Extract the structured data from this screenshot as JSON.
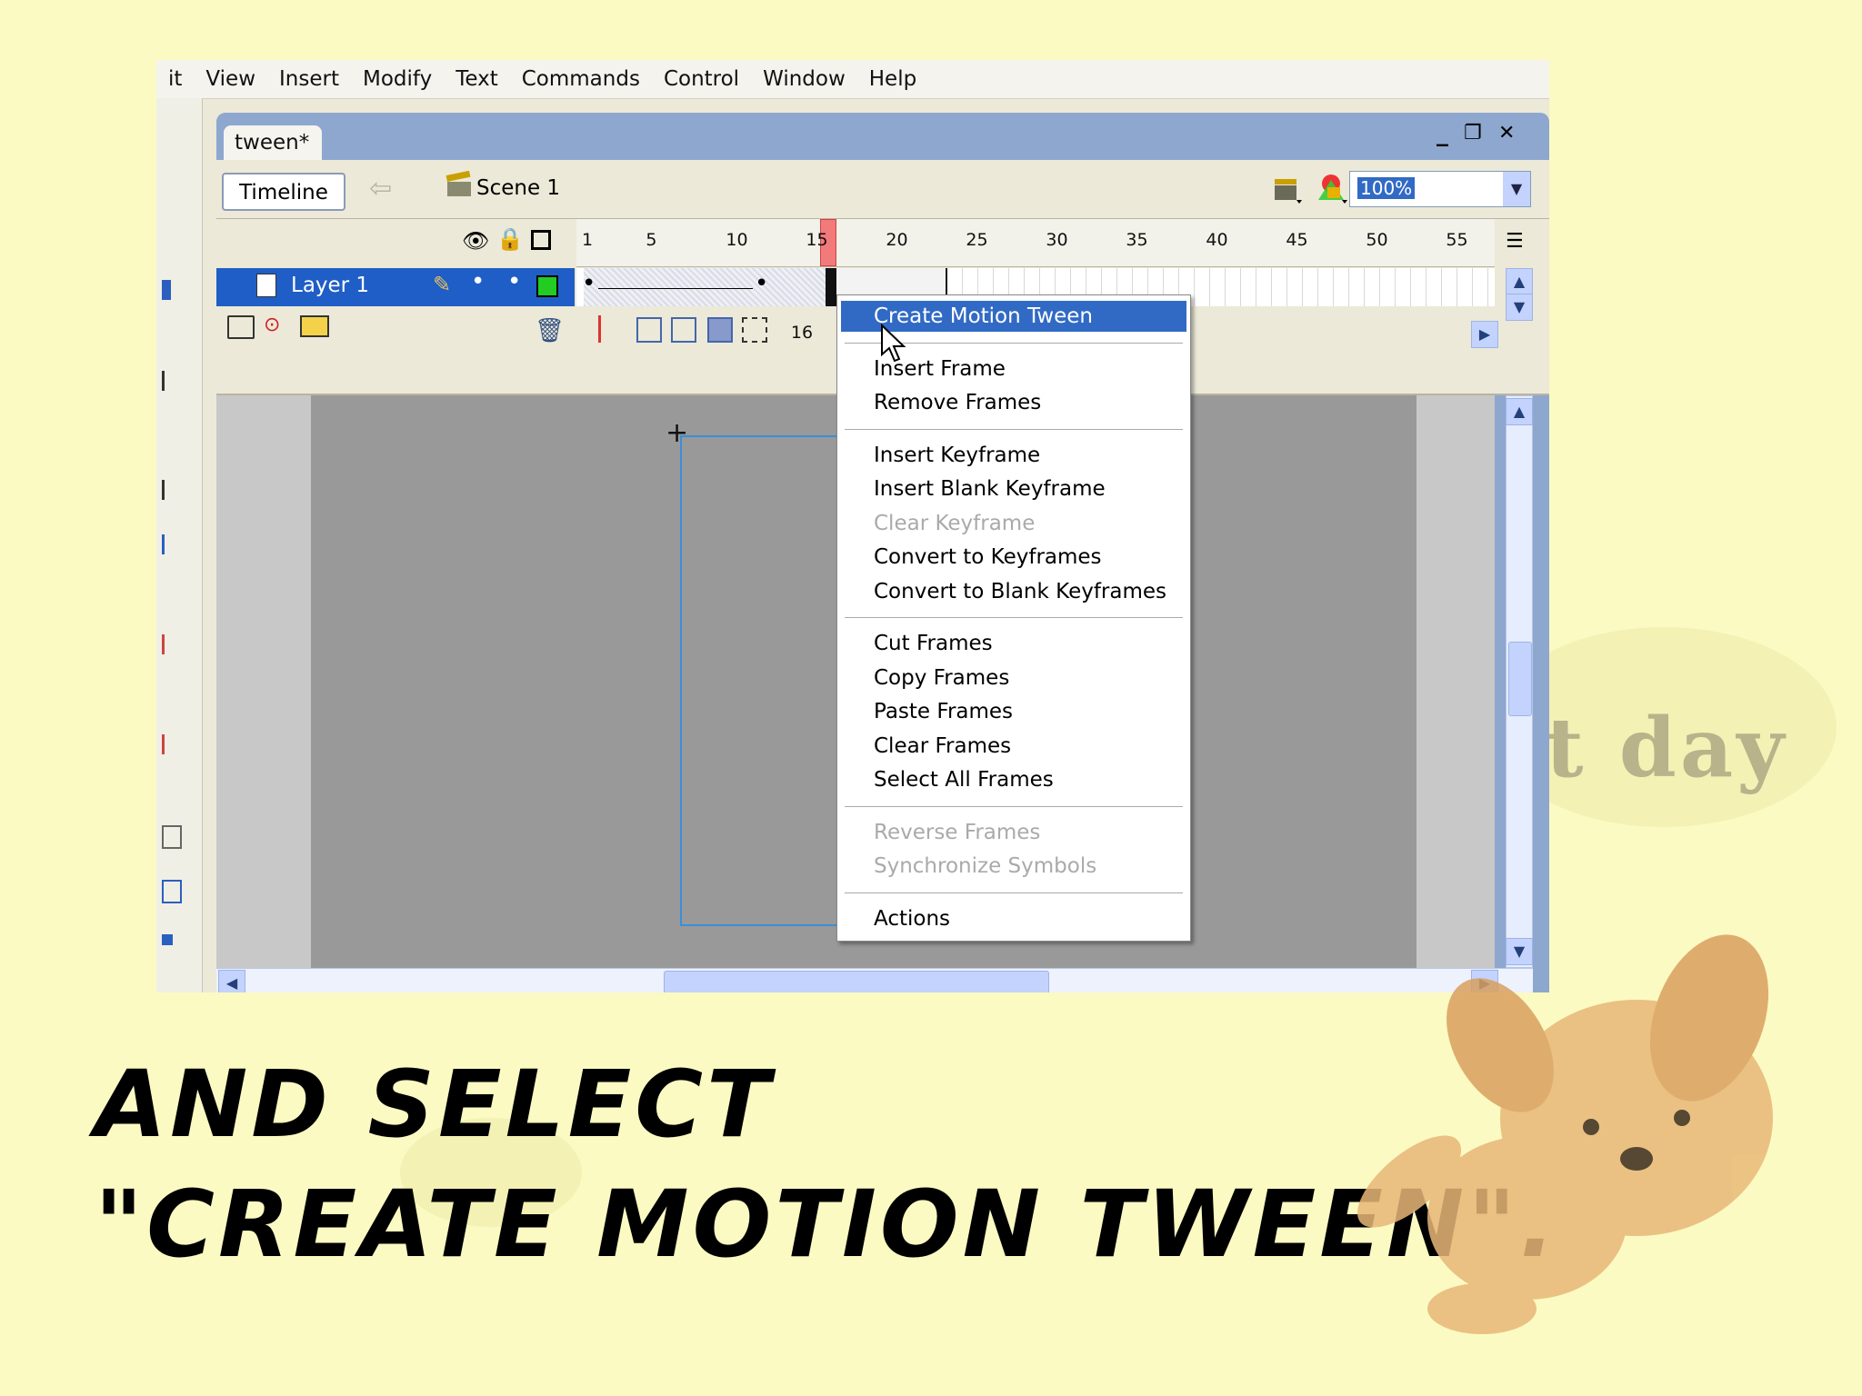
{
  "menubar": {
    "items": [
      "it",
      "View",
      "Insert",
      "Modify",
      "Text",
      "Commands",
      "Control",
      "Window",
      "Help"
    ]
  },
  "document": {
    "tab_label": "tween*",
    "minimize": "_",
    "restore": "❐",
    "close": "✕"
  },
  "edit_bar": {
    "timeline_label": "Timeline",
    "back_icon": "arrow-left-icon",
    "scene_label": "Scene 1",
    "zoom_value": "100%"
  },
  "timeline": {
    "ruler_numbers": [
      "1",
      "5",
      "10",
      "15",
      "20",
      "25",
      "30",
      "35",
      "40",
      "45",
      "50",
      "55"
    ],
    "playhead_frame": 16,
    "layer_name": "Layer 1",
    "current_frame": "16",
    "layer_color": "#22cc22"
  },
  "context_menu": {
    "groups": [
      [
        {
          "label": "Create Motion Tween",
          "state": "highlighted"
        }
      ],
      [
        {
          "label": "Insert Frame",
          "state": "enabled"
        },
        {
          "label": "Remove Frames",
          "state": "enabled"
        }
      ],
      [
        {
          "label": "Insert Keyframe",
          "state": "enabled"
        },
        {
          "label": "Insert Blank Keyframe",
          "state": "enabled"
        },
        {
          "label": "Clear Keyframe",
          "state": "disabled"
        },
        {
          "label": "Convert to Keyframes",
          "state": "enabled"
        },
        {
          "label": "Convert to Blank Keyframes",
          "state": "enabled"
        }
      ],
      [
        {
          "label": "Cut Frames",
          "state": "enabled"
        },
        {
          "label": "Copy Frames",
          "state": "enabled"
        },
        {
          "label": "Paste Frames",
          "state": "enabled"
        },
        {
          "label": "Clear Frames",
          "state": "enabled"
        },
        {
          "label": "Select All Frames",
          "state": "enabled"
        }
      ],
      [
        {
          "label": "Reverse Frames",
          "state": "disabled"
        },
        {
          "label": "Synchronize Symbols",
          "state": "disabled"
        }
      ],
      [
        {
          "label": "Actions",
          "state": "enabled"
        }
      ]
    ]
  },
  "caption": {
    "line1": "And select",
    "line2": "\"Create Motion Tween\"."
  },
  "background_text": "t day",
  "colors": {
    "page_bg": "#fbfac2",
    "highlight": "#316ac5",
    "layer_selected": "#1f5ec6"
  }
}
